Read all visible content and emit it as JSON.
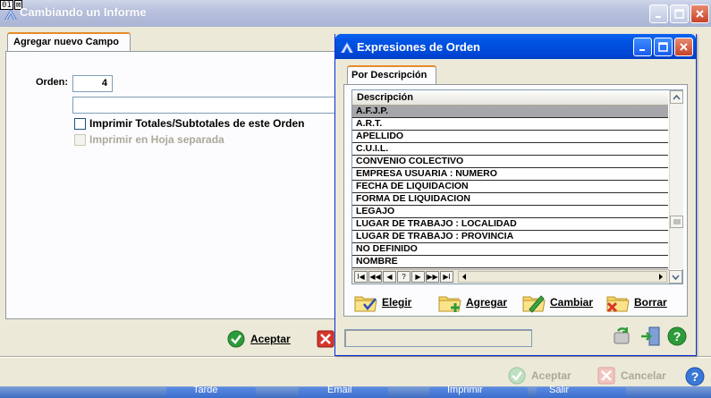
{
  "main_window": {
    "title": "Cambiando un Informe",
    "overlay_badge": [
      "01",
      "⊠"
    ],
    "tab_label": "Agregar nuevo Campo",
    "orden_label": "Orden:",
    "orden_value": "4",
    "name_value": "",
    "chk_totales_label": "Imprimir Totales/Subtotales de este Orden",
    "chk_hoja_label": "Imprimir en Hoja separada",
    "aceptar_label": "Aceptar",
    "bottom_aceptar_label": "Aceptar",
    "bottom_cancelar_label": "Cancelar"
  },
  "dialog": {
    "title": "Expresiones de Orden",
    "tab_label": "Por Descripción",
    "column_header": "Descripción",
    "rows": [
      "A.F.J.P.",
      "A.R.T.",
      "APELLIDO",
      "C.U.I.L.",
      "CONVENIO COLECTIVO",
      "EMPRESA USUARIA : NUMERO",
      "FECHA DE LIQUIDACION",
      "FORMA DE LIQUIDACION",
      "LEGAJO",
      "LUGAR DE TRABAJO : LOCALIDAD",
      "LUGAR DE TRABAJO : PROVINCIA",
      "NO DEFINIDO",
      "NOMBRE"
    ],
    "selected_row": 0,
    "nav_buttons": [
      "I◀",
      "◀◀",
      "◀",
      "?",
      "▶",
      "▶▶",
      "▶I"
    ],
    "actions": {
      "elegir": "Elegir",
      "agregar": "Agregar",
      "cambiar": "Cambiar",
      "borrar": "Borrar"
    },
    "status_text": ""
  },
  "taskbar": {
    "items": [
      "Tarde",
      "Email",
      "Imprimir",
      "Salir"
    ]
  },
  "colors": {
    "title_active": "#0054e3",
    "title_inactive": "#b8c1dd",
    "face": "#ece9d8",
    "tab_highlight": "#e68b2c",
    "selection": "#a7a6aa"
  },
  "icons": {
    "app": "feather-icon",
    "aceptar": "green-check-icon",
    "cancelar": "red-x-icon",
    "elegir": "folder-check-icon",
    "agregar": "folder-add-icon",
    "cambiar": "folder-edit-icon",
    "borrar": "folder-delete-icon",
    "help": "help-icon"
  }
}
